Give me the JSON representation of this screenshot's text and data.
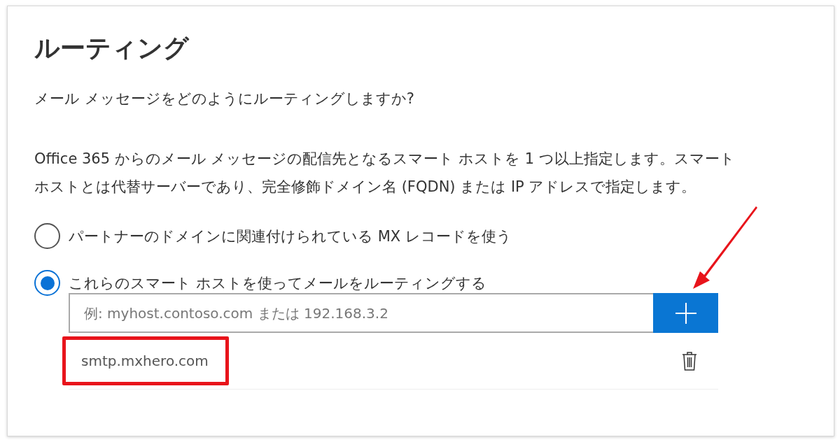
{
  "title": "ルーティング",
  "question": "メール メッセージをどのようにルーティングしますか?",
  "description_lines": [
    "Office 365 からのメール メッセージの配信先となるスマート ホストを 1 つ以上指定します。スマート",
    "ホストとは代替サーバーであり、完全修飾ドメイン名 (FQDN) または IP アドレスで指定します。"
  ],
  "options": [
    {
      "label": "パートナーのドメインに関連付けられている MX レコードを使う",
      "selected": false
    },
    {
      "label": "これらのスマート ホストを使ってメールをルーティングする",
      "selected": true
    }
  ],
  "host_input": {
    "placeholder": "例: myhost.contoso.com または 192.168.3.2",
    "add_button_pointed": true
  },
  "hosts": [
    {
      "value": "smtp.mxhero.com",
      "highlighted": true
    }
  ]
}
